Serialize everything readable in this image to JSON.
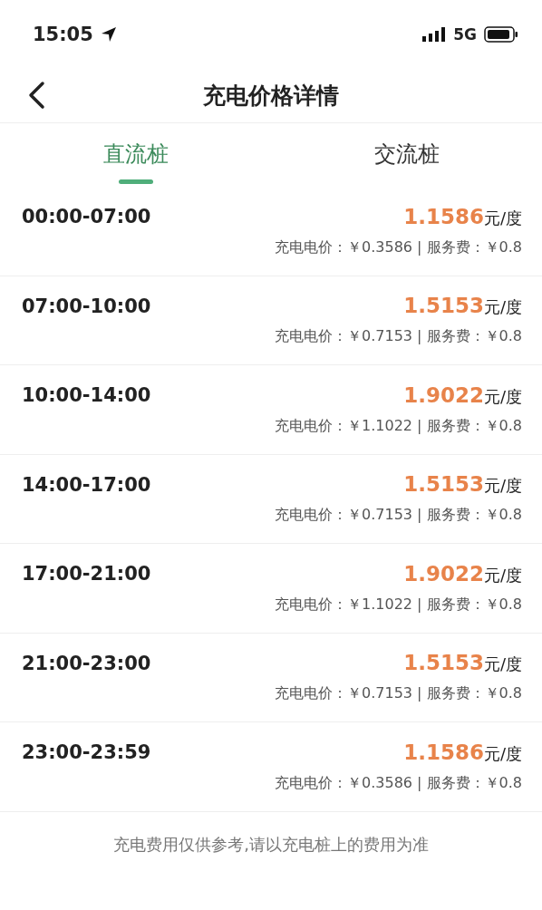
{
  "status_bar": {
    "time": "15:05",
    "network": "5G"
  },
  "header": {
    "title": "充电价格详情"
  },
  "tabs": [
    {
      "label": "直流桩",
      "selected": true
    },
    {
      "label": "交流桩",
      "selected": false
    }
  ],
  "periods": [
    {
      "time": "00:00-07:00",
      "price": "1.1586",
      "unit": "元/度",
      "detail": "充电电价：￥0.3586 | 服务费：￥0.8"
    },
    {
      "time": "07:00-10:00",
      "price": "1.5153",
      "unit": "元/度",
      "detail": "充电电价：￥0.7153 | 服务费：￥0.8"
    },
    {
      "time": "10:00-14:00",
      "price": "1.9022",
      "unit": "元/度",
      "detail": "充电电价：￥1.1022 | 服务费：￥0.8"
    },
    {
      "time": "14:00-17:00",
      "price": "1.5153",
      "unit": "元/度",
      "detail": "充电电价：￥0.7153 | 服务费：￥0.8"
    },
    {
      "time": "17:00-21:00",
      "price": "1.9022",
      "unit": "元/度",
      "detail": "充电电价：￥1.1022 | 服务费：￥0.8"
    },
    {
      "time": "21:00-23:00",
      "price": "1.5153",
      "unit": "元/度",
      "detail": "充电电价：￥0.7153 | 服务费：￥0.8"
    },
    {
      "time": "23:00-23:59",
      "price": "1.1586",
      "unit": "元/度",
      "detail": "充电电价：￥0.3586 | 服务费：￥0.8"
    }
  ],
  "footer_note": "充电费用仅供参考,请以充电桩上的费用为准"
}
